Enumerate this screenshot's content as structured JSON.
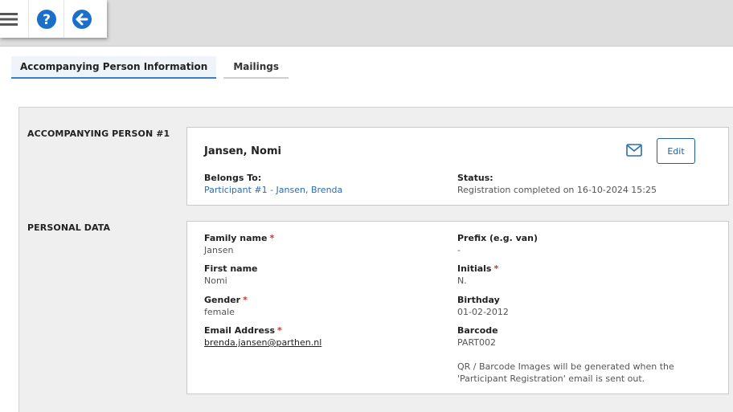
{
  "toolbar": {
    "menu_icon": "hamburger-menu-icon",
    "help_icon": "question-circle-icon",
    "back_icon": "arrow-left-circle-icon",
    "accent": "#1a6fc9"
  },
  "tabs": [
    {
      "label": "Accompanying Person Information",
      "active": true
    },
    {
      "label": "Mailings",
      "active": false
    }
  ],
  "accompanying": {
    "section_label": "ACCOMPANYING PERSON #1",
    "name": "Jansen, Nomi",
    "edit_label": "Edit",
    "mail_icon": "envelope-icon",
    "belongs_to_label": "Belongs To:",
    "belongs_to_value": "Participant #1 - Jansen, Brenda",
    "status_label": "Status:",
    "status_value": "Registration completed on 16-10-2024 15:25"
  },
  "personal": {
    "section_label": "PERSONAL DATA",
    "family_name_label": "Family name",
    "family_name_value": "Jansen",
    "prefix_label": "Prefix (e.g. van)",
    "prefix_value": "-",
    "first_name_label": "First name",
    "first_name_value": "Nomi",
    "initials_label": "Initials",
    "initials_value": "N.",
    "gender_label": "Gender",
    "gender_value": "female",
    "birthday_label": "Birthday",
    "birthday_value": "01-02-2012",
    "email_label": "Email Address",
    "email_value": "brenda.jansen@parthen.nl",
    "barcode_label": "Barcode",
    "barcode_value": "PART002",
    "barcode_note": "QR / Barcode Images will be generated when the 'Participant Registration' email is sent out.",
    "required_mark": "*"
  }
}
